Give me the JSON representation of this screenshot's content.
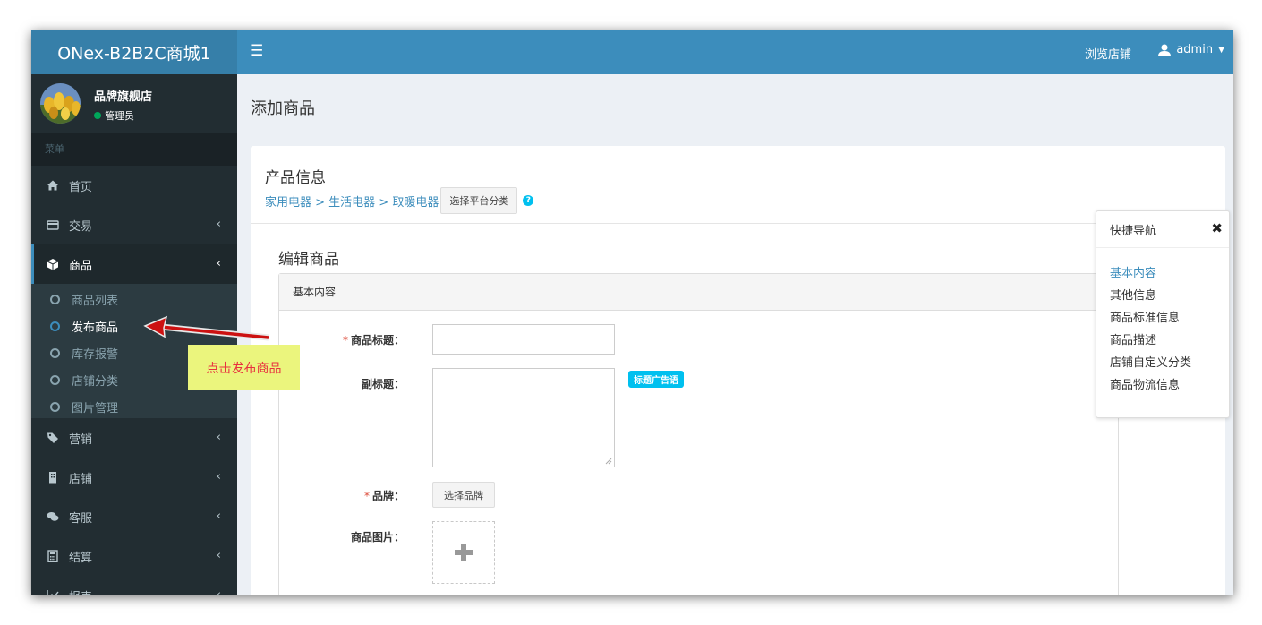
{
  "app": {
    "logo": "ONex-B2B2C商城1"
  },
  "topbar": {
    "browse_store": "浏览店铺",
    "user": "admin"
  },
  "sidebar": {
    "store_name": "品牌旗舰店",
    "role": "管理员",
    "menu_header": "菜单",
    "items": [
      {
        "label": "首页",
        "icon": "home-icon"
      },
      {
        "label": "交易",
        "icon": "credit-card-icon"
      },
      {
        "label": "商品",
        "icon": "cube-icon"
      },
      {
        "label": "营销",
        "icon": "tags-icon"
      },
      {
        "label": "店铺",
        "icon": "building-icon"
      },
      {
        "label": "客服",
        "icon": "comments-icon"
      },
      {
        "label": "结算",
        "icon": "calculator-icon"
      },
      {
        "label": "报表",
        "icon": "chart-icon"
      }
    ],
    "sub_items": [
      "商品列表",
      "发布商品",
      "库存报警",
      "店铺分类",
      "图片管理"
    ]
  },
  "page": {
    "title": "添加商品"
  },
  "product_info": {
    "title": "产品信息",
    "breadcrumb": "家用电器 > 生活电器 > 取暖电器",
    "choose_category": "选择平台分类"
  },
  "edit": {
    "title": "编辑商品",
    "panel_heading": "基本内容",
    "fields": {
      "title_label": "商品标题：",
      "subtitle_label": "副标题：",
      "slogan_badge": "标题广告语",
      "brand_label": "品牌：",
      "brand_button": "选择品牌",
      "image_label": "商品图片："
    }
  },
  "quick_nav": {
    "title": "快捷导航",
    "items": [
      "基本内容",
      "其他信息",
      "商品标准信息",
      "商品描述",
      "店铺自定义分类",
      "商品物流信息"
    ]
  },
  "annotation": {
    "text": "点击发布商品"
  },
  "colors": {
    "header": "#3c8dbc",
    "logo_bg": "#367fa9",
    "sidebar": "#222d32",
    "callout": "#ebf57d",
    "arrow": "#cc1111"
  }
}
